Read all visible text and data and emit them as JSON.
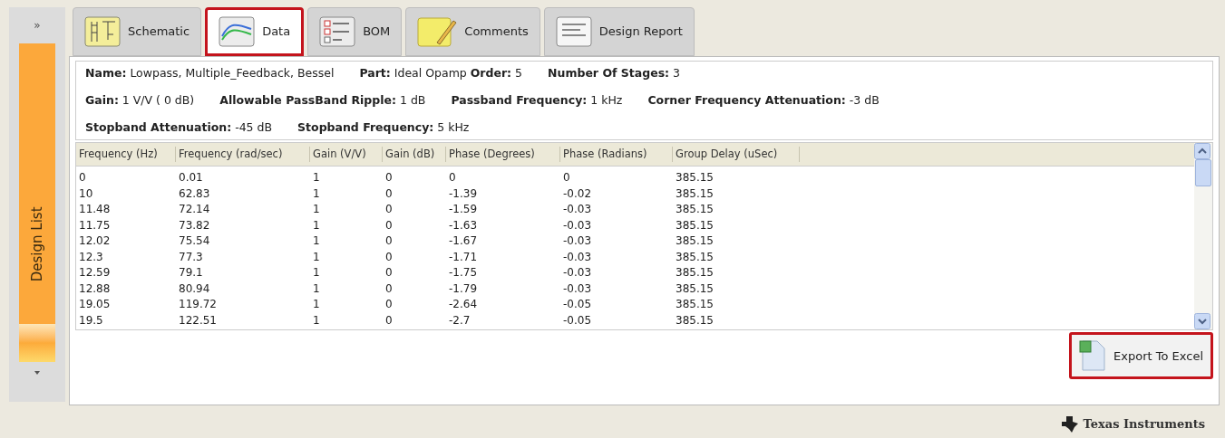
{
  "sidebar": {
    "toggle": "»",
    "label": "Design List"
  },
  "tabs": [
    {
      "label": "Schematic",
      "kind": "schematic",
      "selected": false,
      "highlighted": false
    },
    {
      "label": "Data",
      "kind": "data",
      "selected": true,
      "highlighted": true
    },
    {
      "label": "BOM",
      "kind": "bom",
      "selected": false,
      "highlighted": false
    },
    {
      "label": "Comments",
      "kind": "comments",
      "selected": false,
      "highlighted": false
    },
    {
      "label": "Design Report",
      "kind": "report",
      "selected": false,
      "highlighted": false
    }
  ],
  "info_lines": [
    [
      "**Name:** Lowpass, Multiple_Feedback, Bessel",
      "**Part:** Ideal Opamp **Order:** 5",
      "**Number Of Stages:** 3"
    ],
    [
      "**Gain:** 1 V/V ( 0 dB)",
      "**Allowable PassBand Ripple:** 1 dB",
      "**Passband Frequency:** 1 kHz",
      "**Corner Frequency Attenuation:** -3 dB"
    ],
    [
      "**Stopband Attenuation:** -45 dB",
      "**Stopband Frequency:** 5 kHz"
    ]
  ],
  "table": {
    "columns": [
      "Frequency (Hz)",
      "Frequency (rad/sec)",
      "Gain (V/V)",
      "Gain (dB)",
      "Phase (Degrees)",
      "Phase (Radians)",
      "Group Delay (uSec)"
    ],
    "rows": [
      [
        "0",
        "0.01",
        "1",
        "0",
        "0",
        "0",
        "385.15"
      ],
      [
        "10",
        "62.83",
        "1",
        "0",
        "-1.39",
        "-0.02",
        "385.15"
      ],
      [
        "11.48",
        "72.14",
        "1",
        "0",
        "-1.59",
        "-0.03",
        "385.15"
      ],
      [
        "11.75",
        "73.82",
        "1",
        "0",
        "-1.63",
        "-0.03",
        "385.15"
      ],
      [
        "12.02",
        "75.54",
        "1",
        "0",
        "-1.67",
        "-0.03",
        "385.15"
      ],
      [
        "12.3",
        "77.3",
        "1",
        "0",
        "-1.71",
        "-0.03",
        "385.15"
      ],
      [
        "12.59",
        "79.1",
        "1",
        "0",
        "-1.75",
        "-0.03",
        "385.15"
      ],
      [
        "12.88",
        "80.94",
        "1",
        "0",
        "-1.79",
        "-0.03",
        "385.15"
      ],
      [
        "19.05",
        "119.72",
        "1",
        "0",
        "-2.64",
        "-0.05",
        "385.15"
      ],
      [
        "19.5",
        "122.51",
        "1",
        "0",
        "-2.7",
        "-0.05",
        "385.15"
      ]
    ]
  },
  "export_button": {
    "label": "Export To Excel",
    "highlighted": true
  },
  "footer": {
    "brand": "Texas Instruments"
  }
}
